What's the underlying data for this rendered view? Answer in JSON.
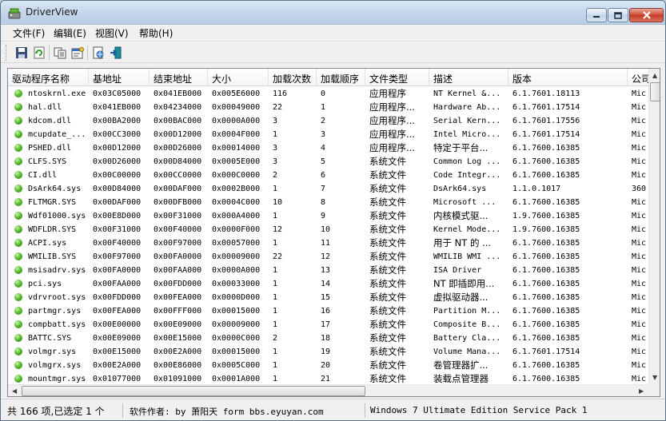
{
  "window": {
    "title": "DriverView"
  },
  "menu": [
    "文件(F)",
    "编辑(E)",
    "视图(V)",
    "帮助(H)"
  ],
  "toolbar": {
    "buttons": [
      {
        "name": "save-icon"
      },
      {
        "name": "refresh-icon"
      },
      {
        "name": "copy-icon"
      },
      {
        "name": "properties-icon"
      },
      {
        "name": "html-report-icon"
      },
      {
        "name": "exit-icon"
      }
    ]
  },
  "columns": [
    "驱动程序名称",
    "基地址",
    "结束地址",
    "大小",
    "加载次数",
    "加载顺序",
    "文件类型",
    "描述",
    "版本",
    "公司"
  ],
  "rows": [
    [
      "ntoskrnl.exe",
      "0x03C05000",
      "0x041EB000",
      "0x005E6000",
      "116",
      "0",
      "应用程序",
      "NT Kernel &...",
      "6.1.7601.18113",
      "Mic"
    ],
    [
      "hal.dll",
      "0x041EB000",
      "0x04234000",
      "0x00049000",
      "22",
      "1",
      "应用程序...",
      "Hardware Ab...",
      "6.1.7601.17514",
      "Mic"
    ],
    [
      "kdcom.dll",
      "0x00BA2000",
      "0x00BAC000",
      "0x0000A000",
      "3",
      "2",
      "应用程序...",
      "Serial Kern...",
      "6.1.7601.17556",
      "Mic"
    ],
    [
      "mcupdate_...",
      "0x00CC3000",
      "0x00D12000",
      "0x0004F000",
      "1",
      "3",
      "应用程序...",
      "Intel Micro...",
      "6.1.7601.17514",
      "Mic"
    ],
    [
      "PSHED.dll",
      "0x00D12000",
      "0x00D26000",
      "0x00014000",
      "3",
      "4",
      "应用程序...",
      "特定于平台...",
      "6.1.7600.16385",
      "Mic"
    ],
    [
      "CLFS.SYS",
      "0x00D26000",
      "0x00D84000",
      "0x0005E000",
      "3",
      "5",
      "系统文件",
      "Common Log ...",
      "6.1.7600.16385",
      "Mic"
    ],
    [
      "CI.dll",
      "0x00C00000",
      "0x00CC0000",
      "0x000C0000",
      "2",
      "6",
      "系统文件",
      "Code Integr...",
      "6.1.7600.16385",
      "Mic"
    ],
    [
      "DsArk64.sys",
      "0x00D84000",
      "0x00DAF000",
      "0x0002B000",
      "1",
      "7",
      "系统文件",
      "DsArk64.sys",
      "1.1.0.1017",
      "360"
    ],
    [
      "FLTMGR.SYS",
      "0x00DAF000",
      "0x00DFB000",
      "0x0004C000",
      "10",
      "8",
      "系统文件",
      "Microsoft ...",
      "6.1.7600.16385",
      "Mic"
    ],
    [
      "Wdf01000.sys",
      "0x00E8D000",
      "0x00F31000",
      "0x000A4000",
      "1",
      "9",
      "系统文件",
      "内核模式驱...",
      "1.9.7600.16385",
      "Mic"
    ],
    [
      "WDFLDR.SYS",
      "0x00F31000",
      "0x00F40000",
      "0x0000F000",
      "12",
      "10",
      "系统文件",
      "Kernel Mode...",
      "1.9.7600.16385",
      "Mic"
    ],
    [
      "ACPI.sys",
      "0x00F40000",
      "0x00F97000",
      "0x00057000",
      "1",
      "11",
      "系统文件",
      "用于 NT 的 ...",
      "6.1.7600.16385",
      "Mic"
    ],
    [
      "WMILIB.SYS",
      "0x00F97000",
      "0x00FA0000",
      "0x00009000",
      "22",
      "12",
      "系统文件",
      "WMILIB WMI ...",
      "6.1.7600.16385",
      "Mic"
    ],
    [
      "msisadrv.sys",
      "0x00FA0000",
      "0x00FAA000",
      "0x0000A000",
      "1",
      "13",
      "系统文件",
      "ISA Driver",
      "6.1.7600.16385",
      "Mic"
    ],
    [
      "pci.sys",
      "0x00FAA000",
      "0x00FDD000",
      "0x00033000",
      "1",
      "14",
      "系统文件",
      "NT 即插即用...",
      "6.1.7600.16385",
      "Mic"
    ],
    [
      "vdrvroot.sys",
      "0x00FDD000",
      "0x00FEA000",
      "0x0000D000",
      "1",
      "15",
      "系统文件",
      "虚拟驱动器...",
      "6.1.7600.16385",
      "Mic"
    ],
    [
      "partmgr.sys",
      "0x00FEA000",
      "0x00FFF000",
      "0x00015000",
      "1",
      "16",
      "系统文件",
      "Partition M...",
      "6.1.7600.16385",
      "Mic"
    ],
    [
      "compbatt.sys",
      "0x00E00000",
      "0x00E09000",
      "0x00009000",
      "1",
      "17",
      "系统文件",
      "Composite B...",
      "6.1.7600.16385",
      "Mic"
    ],
    [
      "BATTC.SYS",
      "0x00E09000",
      "0x00E15000",
      "0x0000C000",
      "2",
      "18",
      "系统文件",
      "Battery Cla...",
      "6.1.7600.16385",
      "Mic"
    ],
    [
      "volmgr.sys",
      "0x00E15000",
      "0x00E2A000",
      "0x00015000",
      "1",
      "19",
      "系统文件",
      "Volume Mana...",
      "6.1.7601.17514",
      "Mic"
    ],
    [
      "volmgrx.sys",
      "0x00E2A000",
      "0x00E86000",
      "0x0005C000",
      "1",
      "20",
      "系统文件",
      "卷管理器扩...",
      "6.1.7600.16385",
      "Mic"
    ],
    [
      "mountmgr.sys",
      "0x01077000",
      "0x01091000",
      "0x0001A000",
      "1",
      "21",
      "系统文件",
      "装载点管理器",
      "6.1.7600.16385",
      "Mic"
    ]
  ],
  "status": {
    "count": "共 166 项,已选定 1 个",
    "author": "软件作者: by 萧阳天 form bbs.eyuyan.com",
    "os": "Windows 7  Ultimate Edition Service Pack 1"
  },
  "colors": {
    "accent": "#4ea72e",
    "selection": "#3399ff"
  }
}
